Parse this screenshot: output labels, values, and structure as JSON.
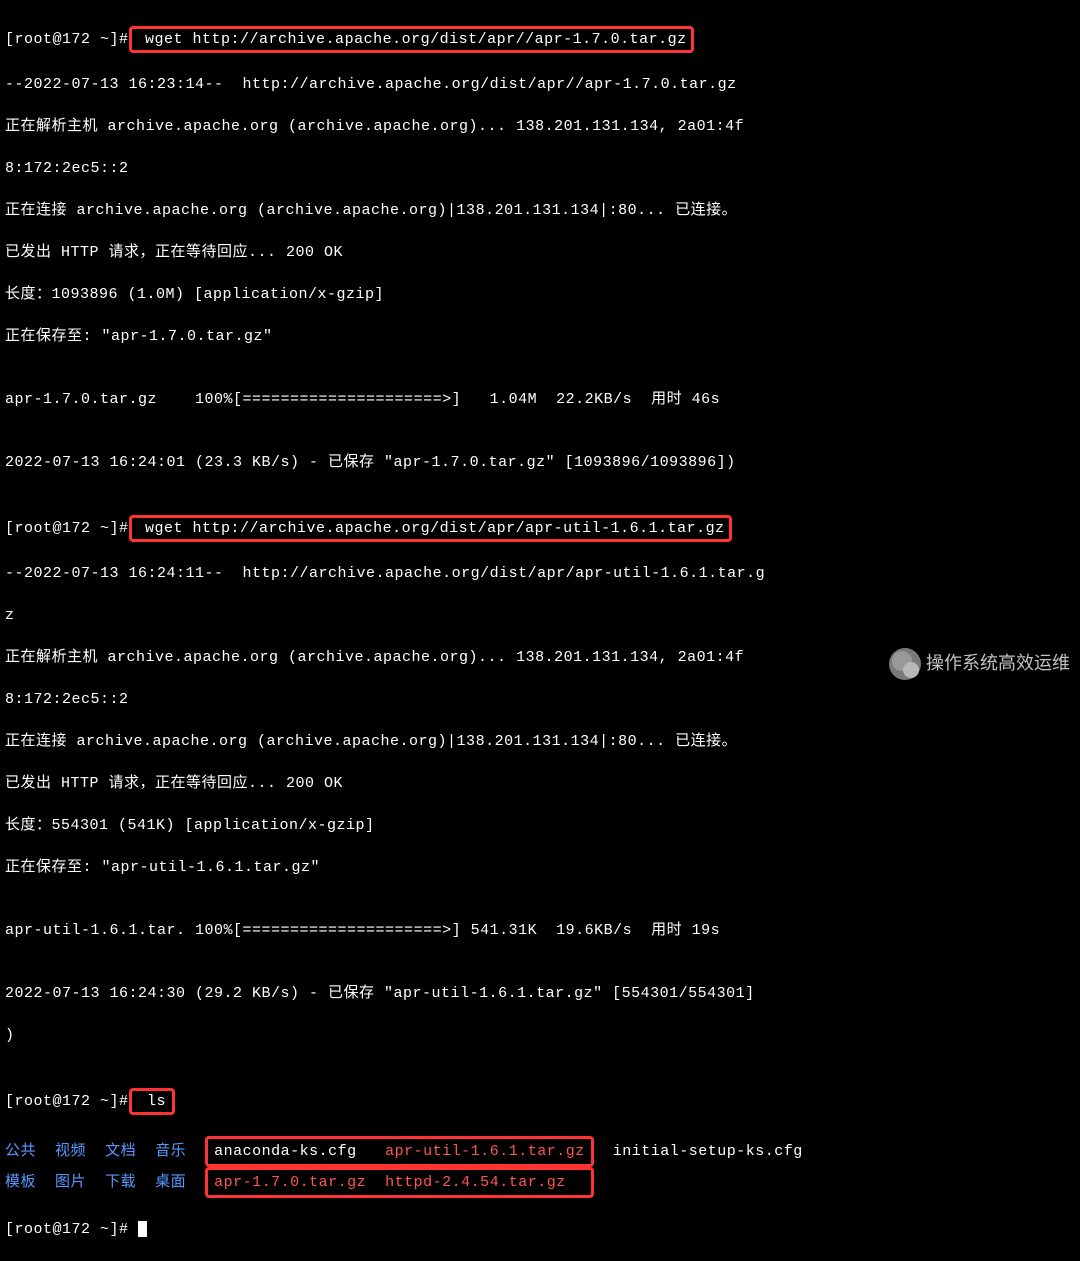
{
  "prompt1": "[root@172 ~]#",
  "cmd1": " wget http://archive.apache.org/dist/apr//apr-1.7.0.tar.gz",
  "line2": "--2022-07-13 16:23:14--  http://archive.apache.org/dist/apr//apr-1.7.0.tar.gz",
  "line3": "正在解析主机 archive.apache.org (archive.apache.org)... 138.201.131.134, 2a01:4f",
  "line4": "8:172:2ec5::2",
  "line5": "正在连接 archive.apache.org (archive.apache.org)|138.201.131.134|:80... 已连接。",
  "line6": "已发出 HTTP 请求，正在等待回应... 200 OK",
  "line7": "长度：1093896 (1.0M) [application/x-gzip]",
  "line8": "正在保存至: \"apr-1.7.0.tar.gz\"",
  "line9": "",
  "line10": "apr-1.7.0.tar.gz    100%[=====================>]   1.04M  22.2KB/s  用时 46s",
  "line11": "",
  "line12": "2022-07-13 16:24:01 (23.3 KB/s) - 已保存 \"apr-1.7.0.tar.gz\" [1093896/1093896])",
  "line13": "",
  "prompt2": "[root@172 ~]#",
  "cmd2": " wget http://archive.apache.org/dist/apr/apr-util-1.6.1.tar.gz",
  "line15": "--2022-07-13 16:24:11--  http://archive.apache.org/dist/apr/apr-util-1.6.1.tar.g",
  "line16": "z",
  "line17": "正在解析主机 archive.apache.org (archive.apache.org)... 138.201.131.134, 2a01:4f",
  "line18": "8:172:2ec5::2",
  "line19": "正在连接 archive.apache.org (archive.apache.org)|138.201.131.134|:80... 已连接。",
  "line20": "已发出 HTTP 请求，正在等待回应... 200 OK",
  "line21": "长度：554301 (541K) [application/x-gzip]",
  "line22": "正在保存至: \"apr-util-1.6.1.tar.gz\"",
  "line23": "",
  "line24": "apr-util-1.6.1.tar. 100%[=====================>] 541.31K  19.6KB/s  用时 19s",
  "line25": "",
  "line26": "2022-07-13 16:24:30 (29.2 KB/s) - 已保存 \"apr-util-1.6.1.tar.gz\" [554301/554301]",
  "line27": ")",
  "line28": "",
  "prompt3": "[root@172 ~]#",
  "cmd3": " ls",
  "dir1_a": "公共",
  "dir1_b": "视频",
  "dir1_c": "文档",
  "dir1_d": "音乐",
  "file1": "anaconda-ks.cfg",
  "file2": "apr-util-1.6.1.tar.gz",
  "file3": "initial-setup-ks.cfg",
  "dir2_a": "模板",
  "dir2_b": "图片",
  "dir2_c": "下载",
  "dir2_d": "桌面",
  "file4": "apr-1.7.0.tar.gz",
  "file5": "httpd-2.4.54.tar.gz",
  "prompt4": "[root@172 ~]# ",
  "watermark": "操作系统高效运维"
}
